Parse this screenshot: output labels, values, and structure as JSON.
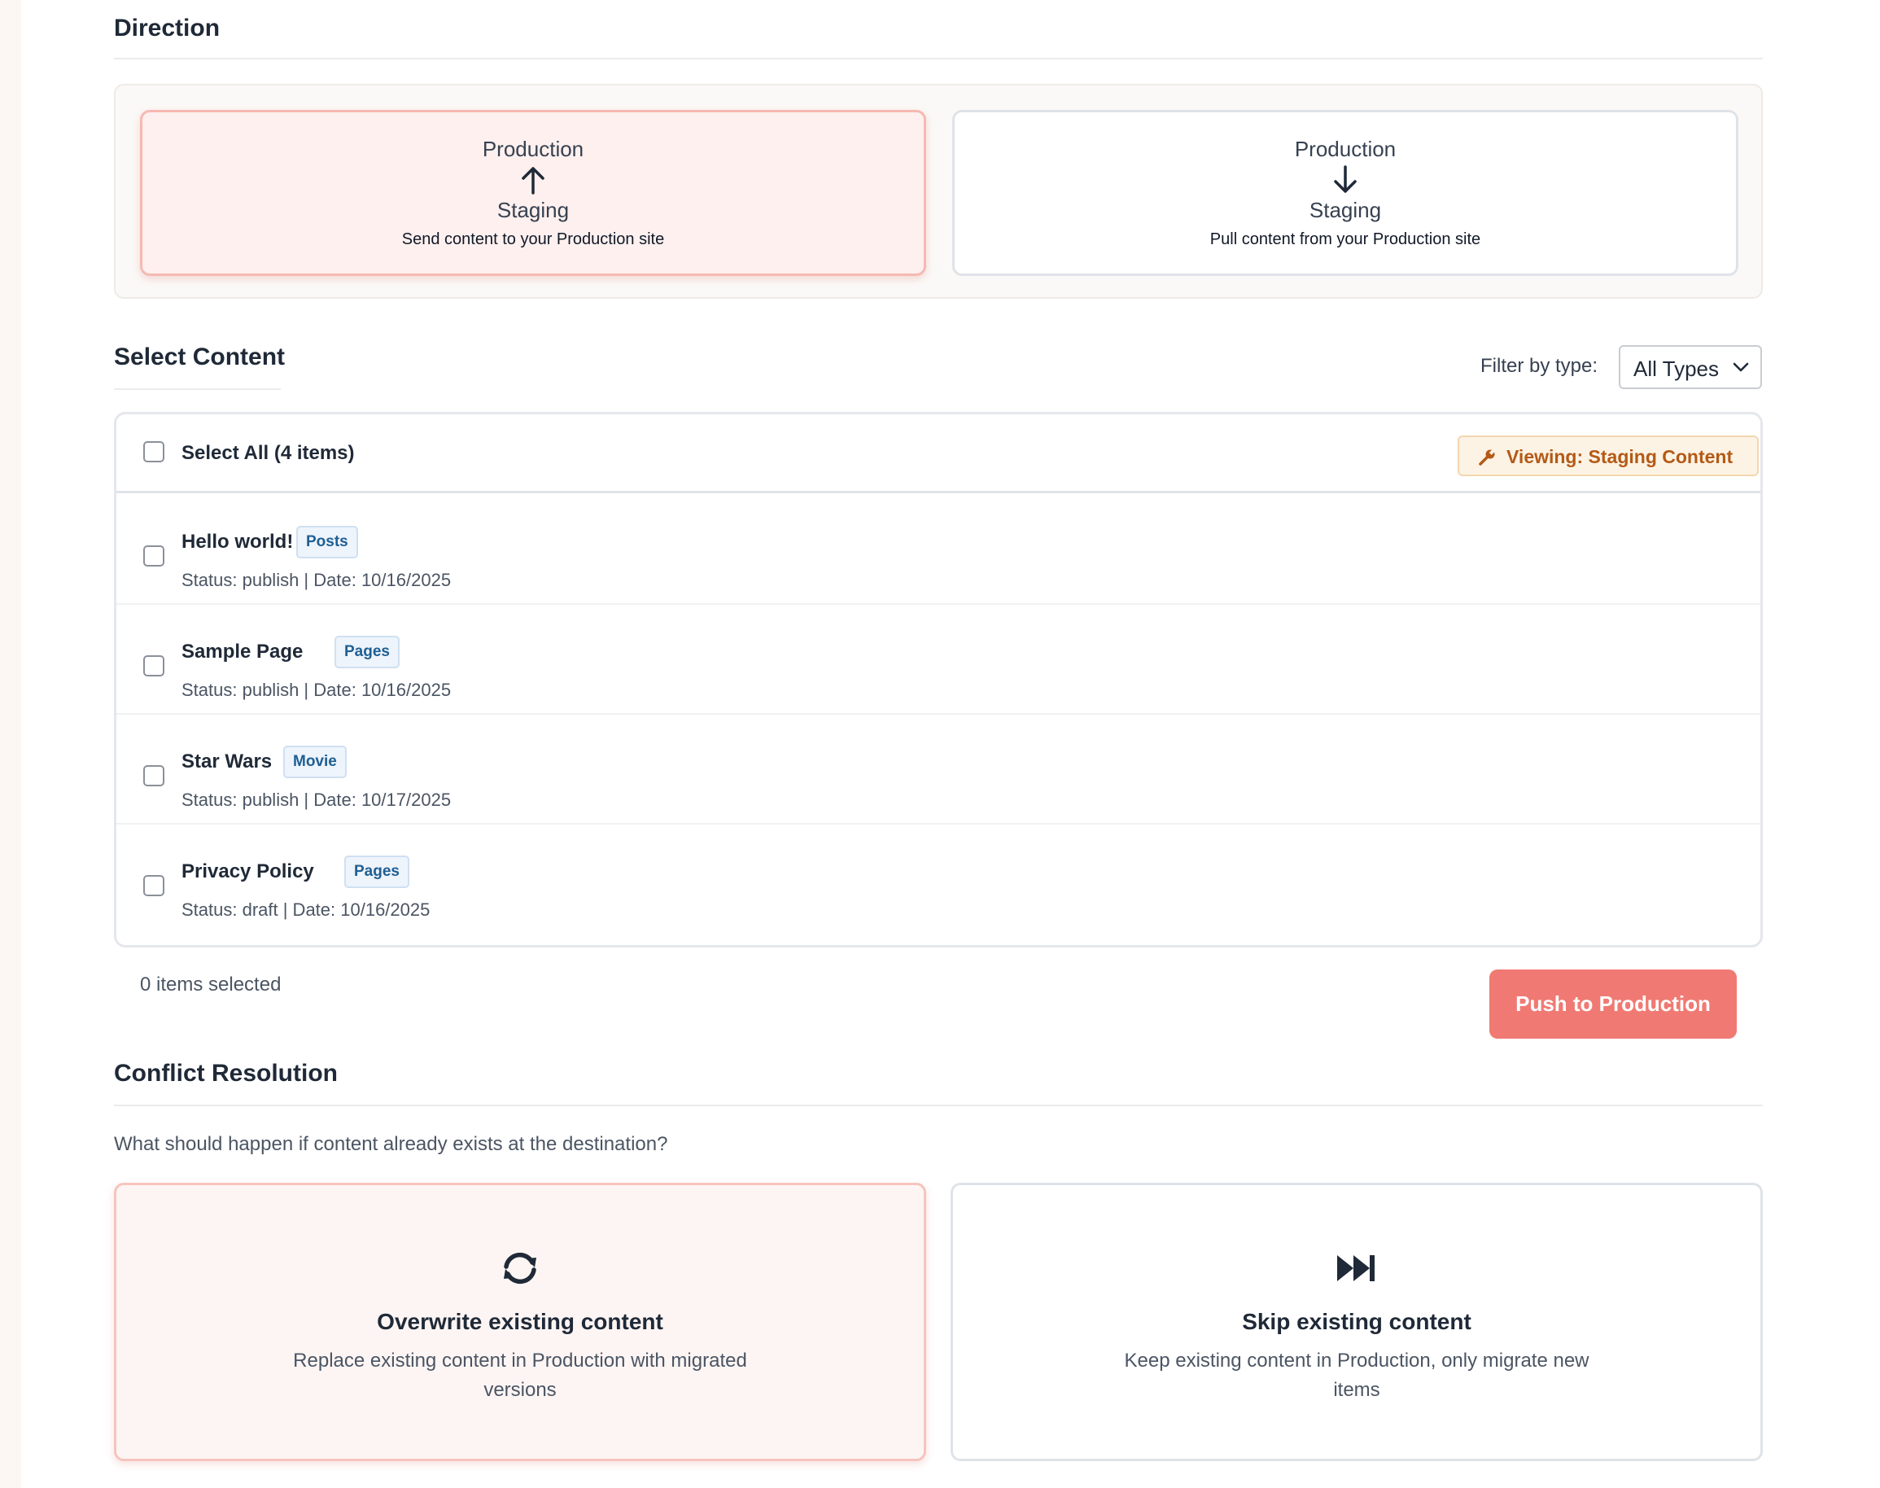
{
  "direction": {
    "title": "Direction",
    "push_card": {
      "top_label": "Production",
      "bottom_label": "Staging",
      "description": "Send content to your Production site",
      "arrow_icon": "arrow-up-icon"
    },
    "pull_card": {
      "top_label": "Production",
      "bottom_label": "Staging",
      "description": "Pull content from your Production site",
      "arrow_icon": "arrow-down-icon"
    }
  },
  "select_content": {
    "title": "Select Content",
    "filter_label": "Filter by type:",
    "filter_value": "All Types",
    "select_all_label": "Select All (4 items)",
    "viewing_badge": "Viewing: Staging Content",
    "items": [
      {
        "title": "Hello world!",
        "type": "Posts",
        "meta": "Status: publish | Date: 10/16/2025"
      },
      {
        "title": "Sample Page",
        "type": "Pages",
        "meta": "Status: publish | Date: 10/16/2025"
      },
      {
        "title": "Star Wars",
        "type": "Movie",
        "meta": "Status: publish | Date: 10/17/2025"
      },
      {
        "title": "Privacy Policy",
        "type": "Pages",
        "meta": "Status: draft | Date: 10/16/2025"
      }
    ],
    "selected_count_text": "0 items selected",
    "push_button": "Push to Production"
  },
  "conflict_resolution": {
    "title": "Conflict Resolution",
    "question": "What should happen if content already exists at the destination?",
    "overwrite": {
      "title": "Overwrite existing content",
      "description": "Replace existing content in Production with migrated versions",
      "icon": "sync-icon"
    },
    "skip": {
      "title": "Skip existing content",
      "description": "Keep existing content in Production, only migrate new items",
      "icon": "skip-forward-icon"
    }
  },
  "colors": {
    "accent": "#f07a73",
    "active_card_bg": "#fdf0ee",
    "badge_text": "#1e5f94",
    "viewing_text": "#b45a16"
  }
}
